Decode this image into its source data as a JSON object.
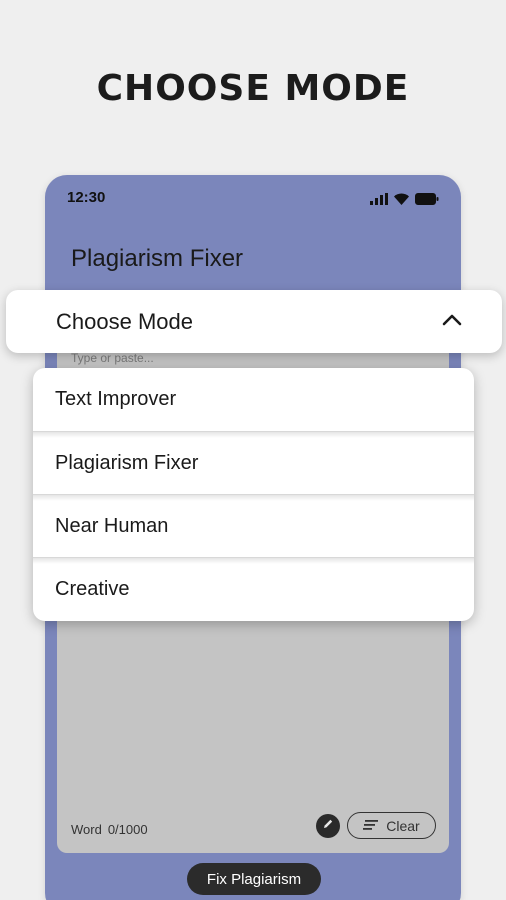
{
  "headline": "CHOOSE MODE",
  "status_bar": {
    "time": "12:30",
    "icons": [
      "signal-icon",
      "wifi-icon",
      "battery-icon"
    ]
  },
  "app": {
    "title": "Plagiarism Fixer"
  },
  "mode_selector": {
    "label": "Choose Mode",
    "icon": "chevron-up-icon",
    "expanded": true
  },
  "dropdown": {
    "options": [
      "Text Improver",
      "Plagiarism Fixer",
      "Near Human",
      "Creative"
    ]
  },
  "editor": {
    "placeholder": "Type or paste...",
    "word_label": "Word",
    "word_count": "0/1000",
    "clear_label": "Clear"
  },
  "action": {
    "fix_label": "Fix Plagiarism"
  },
  "colors": {
    "phone_bg": "#7b86bb",
    "editor_bg": "#c4c4c4",
    "page_bg": "#efefef",
    "button_dark": "#2b2b2b"
  }
}
